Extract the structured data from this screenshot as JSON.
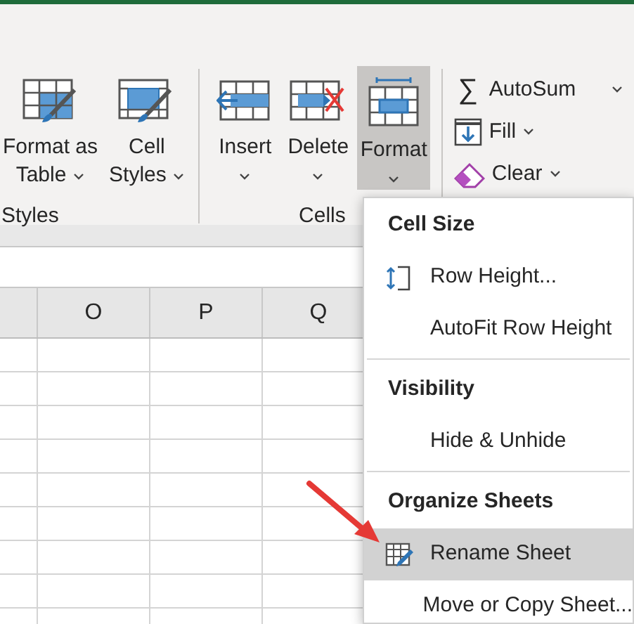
{
  "ribbon": {
    "groups": [
      {
        "label": "Styles",
        "kind": "large",
        "buttons": [
          {
            "kind": "format-table",
            "lines": [
              "Format as",
              "Table"
            ],
            "selected": false
          },
          {
            "kind": "cell-styles",
            "lines": [
              "Cell",
              "Styles"
            ],
            "selected": false
          }
        ]
      },
      {
        "label": "Cells",
        "kind": "large",
        "buttons": [
          {
            "kind": "insert",
            "lines": [
              "Insert"
            ],
            "selected": false
          },
          {
            "kind": "delete",
            "lines": [
              "Delete"
            ],
            "selected": false
          },
          {
            "kind": "format",
            "lines": [
              "Format"
            ],
            "selected": true
          }
        ]
      },
      {
        "kind": "small",
        "buttons": [
          {
            "kind": "autosum",
            "symbol": "∑",
            "label": "AutoSum"
          },
          {
            "kind": "fill",
            "label": "Fill"
          },
          {
            "kind": "clear",
            "label": "Clear"
          }
        ]
      }
    ]
  },
  "sheet": {
    "columns": [
      "O",
      "P",
      "Q"
    ]
  },
  "menu": {
    "sections": [
      {
        "header": "Cell Size",
        "items": [
          {
            "label": "Row Height...",
            "kind": "row-height",
            "selected": false
          },
          {
            "label": "AutoFit Row Height",
            "kind": "plain",
            "selected": false
          }
        ]
      },
      {
        "header": "Visibility",
        "items": [
          {
            "label": "Hide & Unhide",
            "kind": "plain",
            "selected": false
          }
        ]
      },
      {
        "header": "Organize Sheets",
        "items": [
          {
            "label": "Rename Sheet",
            "kind": "rename",
            "selected": true
          },
          {
            "label": "Move or Copy Sheet...",
            "kind": "plain",
            "selected": false
          }
        ]
      }
    ]
  }
}
